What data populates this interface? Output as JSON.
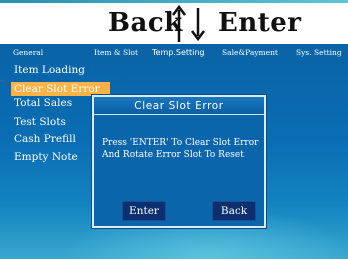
{
  "banner": {
    "back_label": "Back",
    "enter_label": "Enter"
  },
  "tabs": [
    {
      "label": "General"
    },
    {
      "label": "Item & Slot"
    },
    {
      "label": "Temp.Setting"
    },
    {
      "label": "Sale&Payment"
    },
    {
      "label": "Sys. Setting"
    }
  ],
  "menu": {
    "items": [
      {
        "label": "Item Loading"
      },
      {
        "label": "Clear Slot Error"
      },
      {
        "label": "Total Sales"
      },
      {
        "label": "Test Slots"
      },
      {
        "label": "Cash Prefill"
      },
      {
        "label": "Empty Note"
      }
    ]
  },
  "dialog": {
    "title": "Clear Slot Error",
    "message_line1": "Press 'ENTER' To Clear Slot Error",
    "message_line2": "And Rotate Error Slot To Reset",
    "enter_label": "Enter",
    "back_label": "Back"
  },
  "colors": {
    "screen_bg": "#0a6db3",
    "selected_item": "#ffb347",
    "dialog_bg": "#0a65aa",
    "button_bg": "#0b2f6f"
  }
}
